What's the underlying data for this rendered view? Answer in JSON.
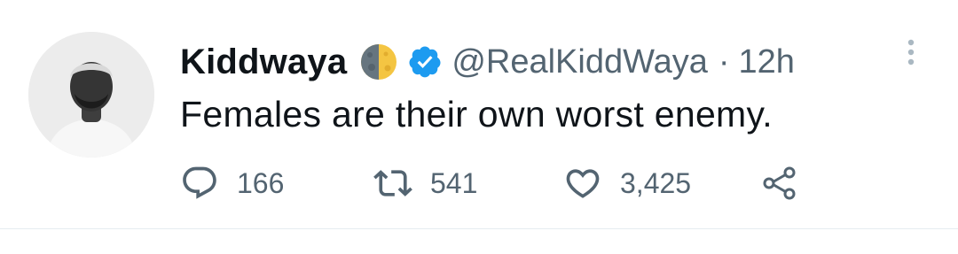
{
  "tweet": {
    "author": {
      "display_name": "Kiddwaya",
      "handle": "@RealKiddWaya",
      "verified": true,
      "emoji_icon": "waxing-gibbous-moon-icon",
      "avatar": "profile-photo"
    },
    "separator": "·",
    "time": "12h",
    "text": "Females are their own worst enemy.",
    "stats": {
      "replies": "166",
      "retweets": "541",
      "likes": "3,425"
    }
  },
  "colors": {
    "text_primary": "#0f1419",
    "text_secondary": "#536471",
    "verified_blue": "#1d9bf0",
    "divider": "#e6ecf0"
  },
  "icons": {
    "reply": "reply-bubble-icon",
    "retweet": "retweet-icon",
    "like": "heart-icon",
    "share": "share-icon",
    "more": "more-vertical-icon"
  }
}
